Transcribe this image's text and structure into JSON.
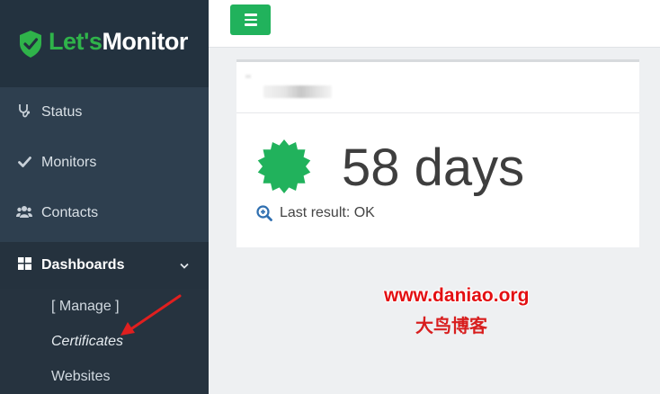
{
  "brand": {
    "logo_lets": "Let's",
    "logo_monitor": "Monitor"
  },
  "sidebar": {
    "items": [
      {
        "label": "Status",
        "icon": "stethoscope-icon"
      },
      {
        "label": "Monitors",
        "icon": "check-icon"
      },
      {
        "label": "Contacts",
        "icon": "users-icon"
      },
      {
        "label": "Dashboards",
        "icon": "dashboard-grid-icon",
        "expanded": true
      }
    ],
    "sub_items": [
      {
        "label": "[ Manage ]"
      },
      {
        "label": "Certificates",
        "current": true
      },
      {
        "label": "Websites"
      }
    ]
  },
  "topbar": {
    "menu_icon": "hamburger-icon"
  },
  "card": {
    "value": "58 days",
    "result_label": "Last result: OK",
    "badge_color": "#21b25c"
  },
  "watermark": {
    "url": "www.daniao.org",
    "name": "大鸟博客",
    "color": "#e30f12"
  },
  "colors": {
    "sidebar": "#2e3f4f",
    "brand_bg": "#23323f",
    "accent": "#21b25c"
  }
}
